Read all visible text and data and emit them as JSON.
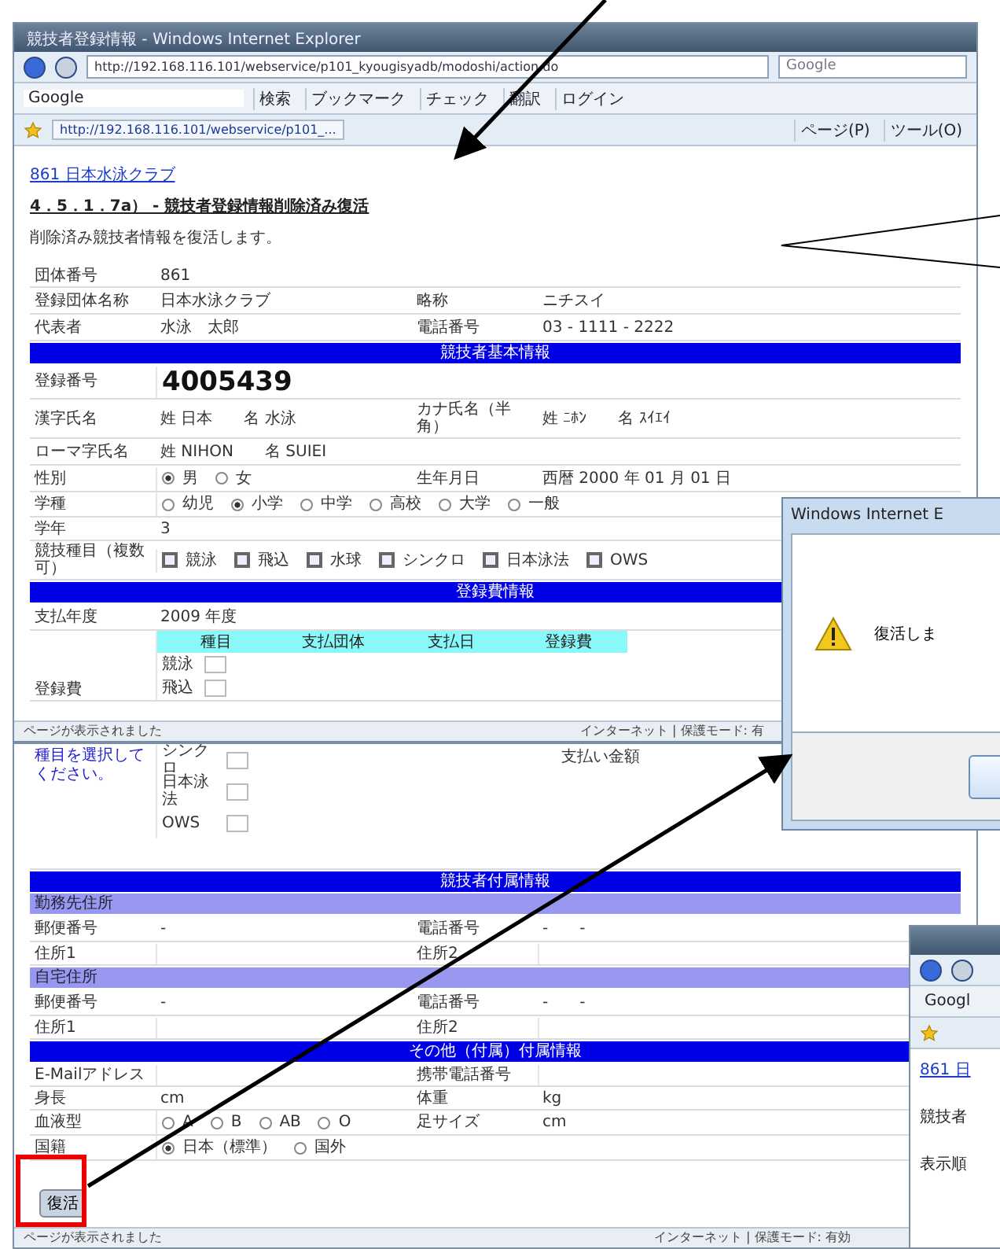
{
  "browser": {
    "title": "競技者登録情報 - Windows Internet Explorer",
    "address": "http://192.168.116.101/webservice/p101_kyougisyadb/modoshi/action.do",
    "search": "Google",
    "google_label": "Google",
    "toolbar": [
      "検索",
      "ブックマーク",
      "チェック",
      "翻訳",
      "ログイン"
    ],
    "tab": "http://192.168.116.101/webservice/p101_...",
    "commands": [
      "ページ(P)",
      "ツール(O)"
    ],
    "status": {
      "left": "ページが表示されました",
      "right": "インターネット | 保護モード: 有"
    }
  },
  "lower_status": {
    "left": "ページが表示されました",
    "right": "インターネット | 保護モード: 有効"
  },
  "page": {
    "club_link": "861 日本水泳クラブ",
    "heading": "4．5．1．7a） - 競技者登録情報削除済み復活",
    "description": "削除済み競技者情報を復活します。"
  },
  "form_top": [
    {
      "kind": "fields",
      "cells": [
        {
          "label": "団体番号",
          "value": "861"
        }
      ]
    },
    {
      "kind": "fields",
      "cells": [
        {
          "label": "登録団体名称",
          "value": "日本水泳クラブ"
        },
        {
          "label": "略称",
          "value": "ニチスイ"
        }
      ]
    },
    {
      "kind": "fields",
      "cells": [
        {
          "label": "代表者",
          "value": "水泳　太郎"
        },
        {
          "label": "電話番号",
          "value": "03 - 1111 - 2222"
        }
      ]
    },
    {
      "kind": "band",
      "title": "競技者基本情報"
    },
    {
      "kind": "number",
      "label": "登録番号",
      "value": "4005439"
    },
    {
      "kind": "fields",
      "cells": [
        {
          "label": "漢字氏名",
          "value": "姓 日本　　名 水泳"
        },
        {
          "label": "カナ氏名（半角）",
          "value": "姓 ﾆﾎﾝ　　名 ｽｲｴｲ"
        }
      ]
    },
    {
      "kind": "fields",
      "cells": [
        {
          "label": "ローマ字氏名",
          "value": "姓 NIHON　　名 SUIEI"
        }
      ]
    },
    {
      "kind": "fields",
      "cells": [
        {
          "label": "性別",
          "kind": "radio",
          "options": [
            {
              "label": "男",
              "selected": true
            },
            {
              "label": "女",
              "selected": false
            }
          ]
        },
        {
          "label": "生年月日",
          "value": "西暦 2000 年 01 月 01 日"
        }
      ]
    },
    {
      "kind": "fields",
      "cells": [
        {
          "label": "学種",
          "kind": "radio",
          "options": [
            {
              "label": "幼児",
              "selected": false
            },
            {
              "label": "小学",
              "selected": true
            },
            {
              "label": "中学",
              "selected": false
            },
            {
              "label": "高校",
              "selected": false
            },
            {
              "label": "大学",
              "selected": false
            },
            {
              "label": "一般",
              "selected": false
            }
          ]
        }
      ]
    },
    {
      "kind": "fields",
      "cells": [
        {
          "label": "学年",
          "value": "3"
        }
      ]
    },
    {
      "kind": "fields",
      "cells": [
        {
          "label": "競技種目（複数可）",
          "kind": "checkbox",
          "options": [
            {
              "label": "競泳",
              "selected": false
            },
            {
              "label": "飛込",
              "selected": false
            },
            {
              "label": "水球",
              "selected": false
            },
            {
              "label": "シンクロ",
              "selected": false
            },
            {
              "label": "日本泳法",
              "selected": false
            },
            {
              "label": "OWS",
              "selected": false
            }
          ]
        }
      ]
    },
    {
      "kind": "band",
      "title": "登録費情報"
    },
    {
      "kind": "fields",
      "cells": [
        {
          "label": "支払年度",
          "value": "2009 年度"
        }
      ]
    },
    {
      "kind": "fee",
      "label": "登録費",
      "columns": [
        "種目",
        "支払団体",
        "支払日",
        "登録費"
      ],
      "rows": [
        "競泳",
        "飛込"
      ]
    }
  ],
  "form_bottom": [
    {
      "kind": "fee_rest",
      "hint": "種目を選択してください。",
      "rows": [
        "シンクロ",
        "日本泳法",
        "OWS"
      ],
      "total_label": "支払い金額"
    },
    {
      "kind": "band",
      "title": "競技者付属情報"
    },
    {
      "kind": "subband",
      "title": "勤務先住所"
    },
    {
      "kind": "fields",
      "cells": [
        {
          "label": "郵便番号",
          "value": "-"
        },
        {
          "label": "電話番号",
          "value": "-　　-"
        }
      ]
    },
    {
      "kind": "fields",
      "cells": [
        {
          "label": "住所1"
        },
        {
          "label": "住所2"
        }
      ]
    },
    {
      "kind": "subband",
      "title": "自宅住所"
    },
    {
      "kind": "fields",
      "cells": [
        {
          "label": "郵便番号",
          "value": "-"
        },
        {
          "label": "電話番号",
          "value": "-　　-"
        }
      ]
    },
    {
      "kind": "fields",
      "cells": [
        {
          "label": "住所1"
        },
        {
          "label": "住所2"
        }
      ]
    },
    {
      "kind": "band",
      "title": "その他（付属）付属情報"
    },
    {
      "kind": "fields",
      "cells": [
        {
          "label": "E-Mailアドレス"
        },
        {
          "label": "携帯電話番号"
        }
      ]
    },
    {
      "kind": "fields",
      "cells": [
        {
          "label": "身長",
          "value": "cm"
        },
        {
          "label": "体重",
          "value": "kg"
        }
      ]
    },
    {
      "kind": "fields",
      "cells": [
        {
          "label": "血液型",
          "kind": "radio",
          "options": [
            {
              "label": "A",
              "selected": false
            },
            {
              "label": "B",
              "selected": false
            },
            {
              "label": "AB",
              "selected": false
            },
            {
              "label": "O",
              "selected": false
            }
          ]
        },
        {
          "label": "足サイズ",
          "value": "cm"
        }
      ]
    },
    {
      "kind": "fields",
      "cells": [
        {
          "label": "国籍",
          "kind": "radio",
          "options": [
            {
              "label": "日本（標準）",
              "selected": true
            },
            {
              "label": "国外",
              "selected": false
            }
          ]
        }
      ]
    }
  ],
  "restore_button": "復活",
  "dialog": {
    "title": "Windows Internet E",
    "message": "復活しま"
  },
  "third_window": {
    "google_label": "Googl",
    "club_link": "861 日",
    "lines": [
      "競技者",
      "表示順"
    ]
  }
}
